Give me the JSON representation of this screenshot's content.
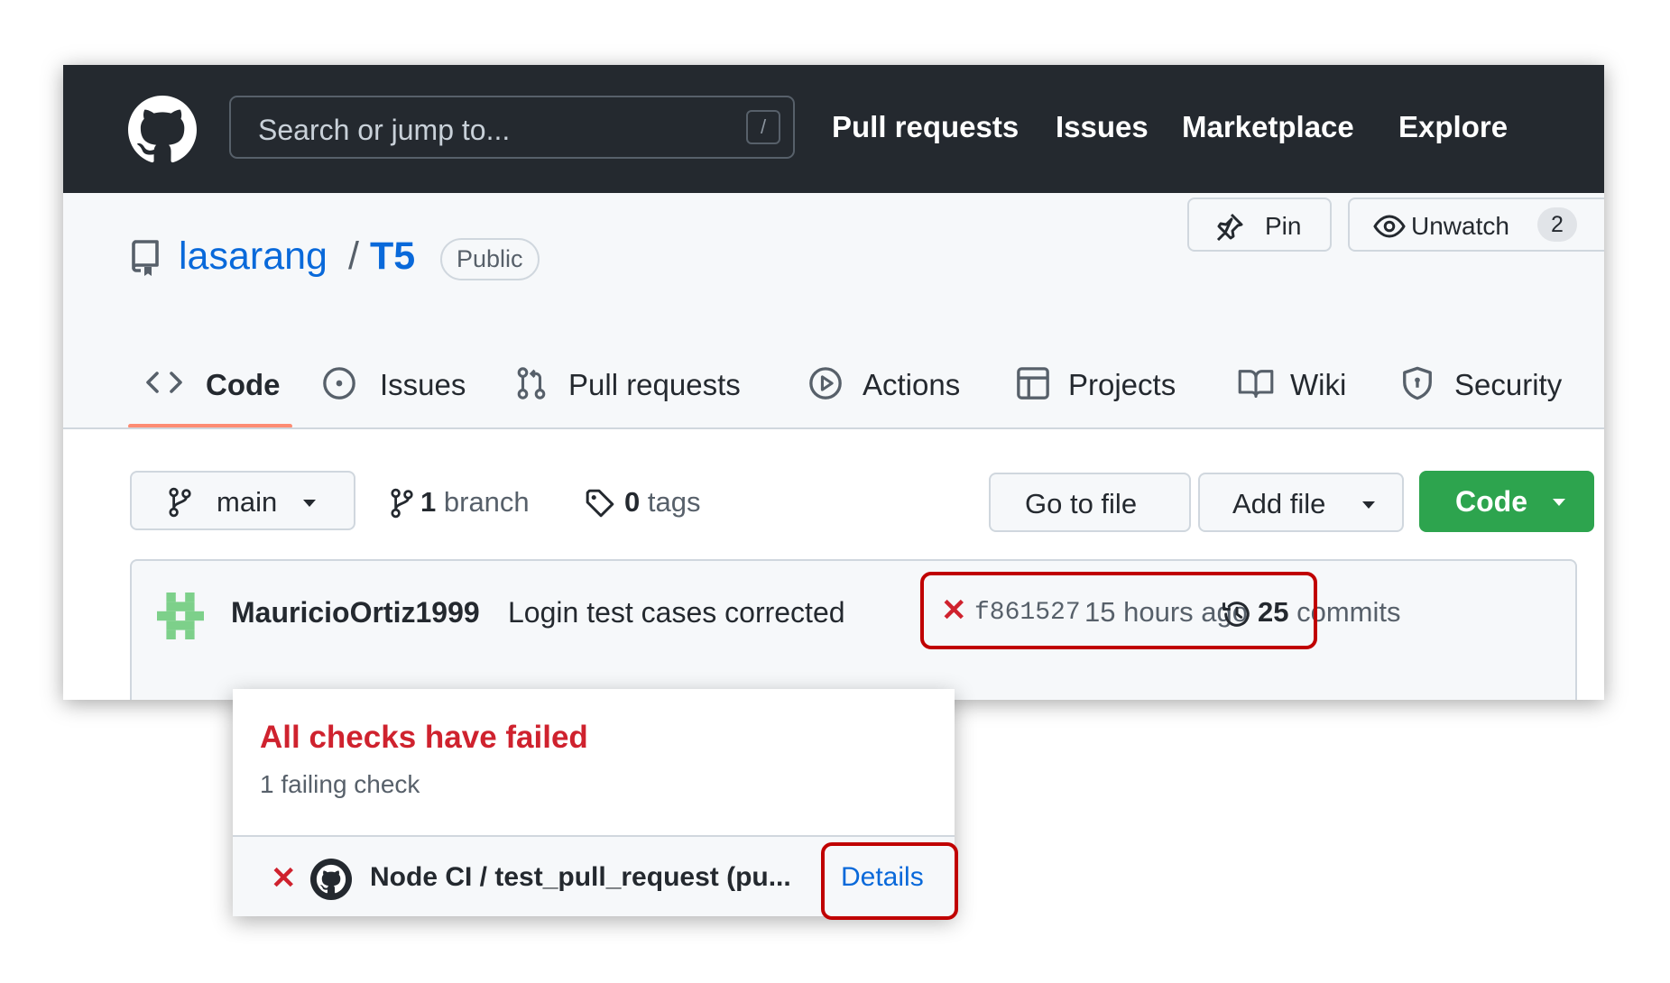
{
  "header": {
    "search_placeholder": "Search or jump to...",
    "search_shortcut": "/",
    "nav": [
      "Pull requests",
      "Issues",
      "Marketplace",
      "Explore"
    ]
  },
  "repo": {
    "owner": "lasarang",
    "separator": "/",
    "name": "T5",
    "visibility": "Public",
    "pin_label": "Pin",
    "unwatch_label": "Unwatch",
    "watch_count": "2"
  },
  "tabs": [
    {
      "label": "Code",
      "icon": "code-icon",
      "selected": true
    },
    {
      "label": "Issues",
      "icon": "issue-opened-icon"
    },
    {
      "label": "Pull requests",
      "icon": "git-pull-request-icon"
    },
    {
      "label": "Actions",
      "icon": "play-icon"
    },
    {
      "label": "Projects",
      "icon": "table-icon"
    },
    {
      "label": "Wiki",
      "icon": "book-icon"
    },
    {
      "label": "Security",
      "icon": "shield-icon"
    }
  ],
  "branch_bar": {
    "branch": "main",
    "branch_count": "1",
    "branch_word": "branch",
    "tag_count": "0",
    "tag_word": "tags",
    "go_to_file": "Go to file",
    "add_file": "Add file",
    "code": "Code"
  },
  "commit": {
    "author": "MauricioOrtiz1999",
    "message": "Login test cases corrected",
    "status_icon": "x-icon",
    "sha": "f861527",
    "time": "15 hours ago",
    "commit_count": "25",
    "commit_word": "commits"
  },
  "popup": {
    "title": "All checks have failed",
    "subtitle": "1 failing check",
    "check_name": "Node CI / test_pull_request (pu...",
    "details": "Details"
  },
  "colors": {
    "topbar": "#24292f",
    "link": "#0969da",
    "danger": "#cf222e",
    "success": "#2da44e",
    "annotation": "#c00000",
    "tab_underline": "#fd8c73"
  }
}
